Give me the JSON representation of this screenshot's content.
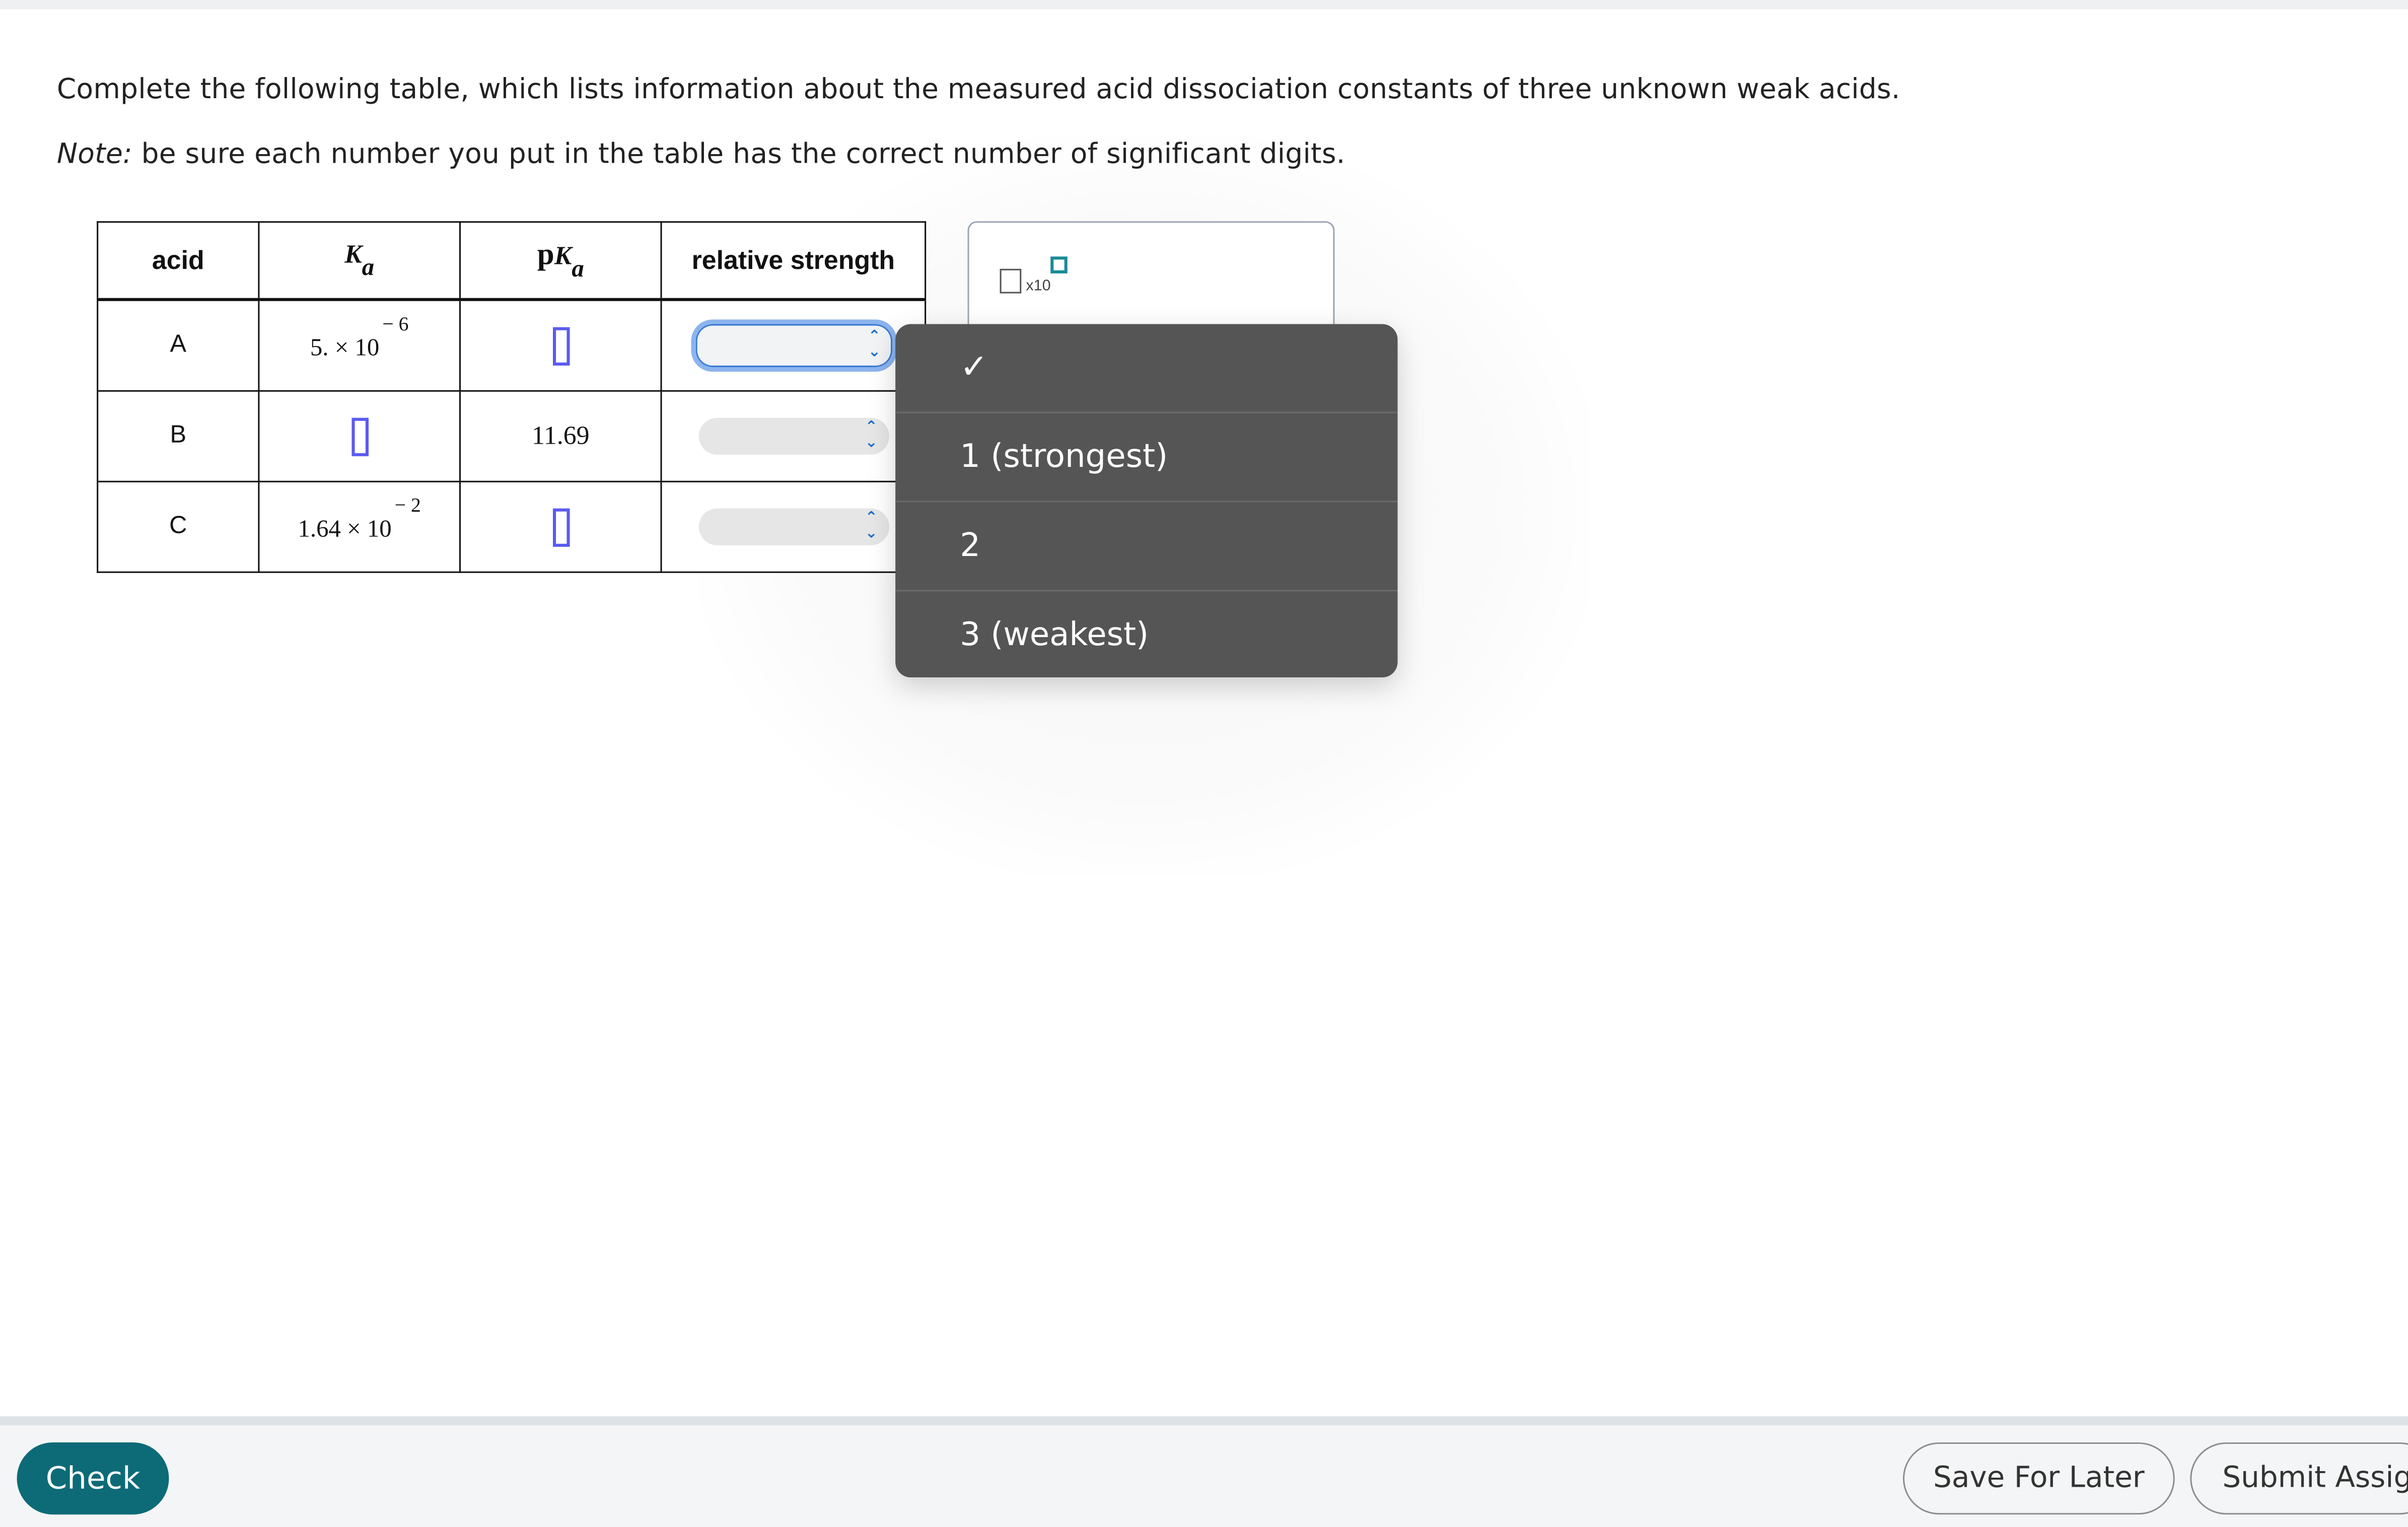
{
  "instructions": {
    "line1": "Complete the following table, which lists information about the measured acid dissociation constants of three unknown weak acids.",
    "note_label": "Note:",
    "note_text": " be sure each number you put in the table has the correct number of significant digits."
  },
  "table": {
    "headers": {
      "acid": "acid",
      "ka_symbol": "K",
      "ka_sub": "a",
      "pka_prefix": "p",
      "pka_symbol": "K",
      "pka_sub": "a",
      "strength": "relative strength"
    },
    "rows": [
      {
        "acid": "A",
        "ka_mantissa": "5. × 10",
        "ka_exp": "− 6",
        "pka": ""
      },
      {
        "acid": "B",
        "ka_mantissa": "",
        "ka_exp": "",
        "pka": "11.69"
      },
      {
        "acid": "C",
        "ka_mantissa": "1.64 × 10",
        "ka_exp": "− 2",
        "pka": ""
      }
    ]
  },
  "math_tool": {
    "label": "x10"
  },
  "dropdown": {
    "options": [
      "1 (strongest)",
      "2",
      "3 (weakest)"
    ],
    "check_glyph": "✓"
  },
  "footer": {
    "check_label": "Check",
    "save_label": "Save For Later",
    "submit_label": "Submit Assig"
  },
  "icons": {
    "select_chevron": "chevron-updown-icon",
    "check": "checkmark-icon"
  },
  "colors": {
    "primary": "#0c6b77",
    "blank_border": "#5b5bf0",
    "popup_bg": "#555555",
    "focus_ring": "#8cb4ee"
  }
}
